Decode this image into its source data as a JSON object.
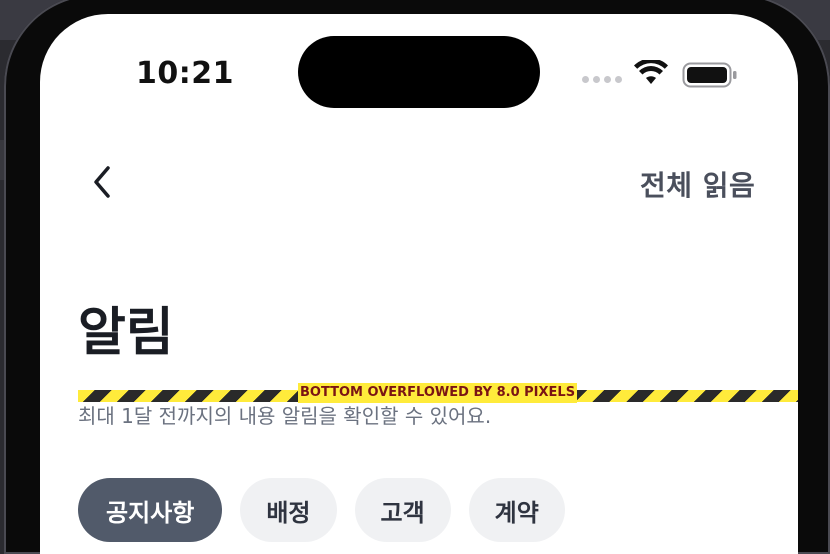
{
  "status_bar": {
    "time": "10:21"
  },
  "header": {
    "read_all_label": "전체 읽음"
  },
  "page": {
    "title": "알림",
    "subtitle": "최대 1달 전까지의 내용 알림을 확인할 수 있어요.",
    "overflow_error": "BOTTOM OVERFLOWED BY 8.0 PIXELS"
  },
  "tabs": [
    {
      "label": "공지사항",
      "active": true
    },
    {
      "label": "배정",
      "active": false
    },
    {
      "label": "고객",
      "active": false
    },
    {
      "label": "계약",
      "active": false
    }
  ],
  "colors": {
    "chip_active_bg": "#515a6a",
    "chip_bg": "#f0f1f3",
    "overflow_stripe": "#ffeb3b"
  },
  "icons": {
    "back": "chevron-left-icon",
    "wifi": "wifi-icon",
    "battery": "battery-icon",
    "signal": "cellular-signal-icon"
  }
}
